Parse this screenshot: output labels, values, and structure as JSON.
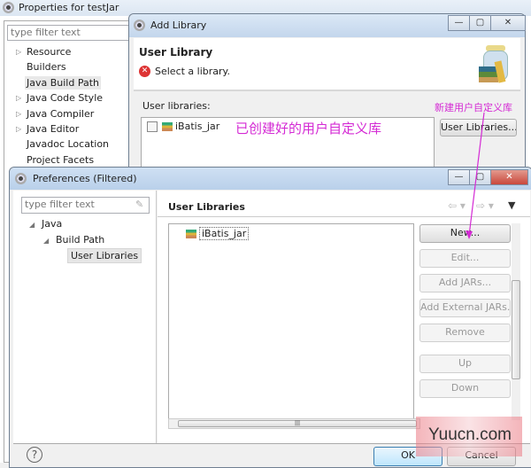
{
  "properties_window": {
    "title": "Properties for testJar",
    "filter_placeholder": "type filter text",
    "tree": [
      {
        "label": "Resource",
        "expandable": true
      },
      {
        "label": "Builders",
        "expandable": false
      },
      {
        "label": "Java Build Path",
        "expandable": false,
        "selected": true
      },
      {
        "label": "Java Code Style",
        "expandable": true
      },
      {
        "label": "Java Compiler",
        "expandable": true
      },
      {
        "label": "Java Editor",
        "expandable": true
      },
      {
        "label": "Javadoc Location",
        "expandable": false
      },
      {
        "label": "Project Facets",
        "expandable": false
      }
    ]
  },
  "add_library_dialog": {
    "title": "Add Library",
    "header_title": "User Library",
    "error_message": "Select a library.",
    "list_label": "User libraries:",
    "libraries": [
      {
        "label": "iBatis_jar",
        "checked": false
      }
    ],
    "user_libraries_button": "User Libraries...",
    "window_buttons": {
      "minimize": "—",
      "maximize": "▢",
      "close": "✕"
    }
  },
  "annotations": {
    "created_library_note": "已创建好的用户自定义库",
    "new_library_note": "新建用户自定义库",
    "color": "#d42ad4"
  },
  "preferences_dialog": {
    "title": "Preferences (Filtered)",
    "filter_placeholder": "type filter text",
    "tree": [
      {
        "label": "Java",
        "level": 0
      },
      {
        "label": "Build Path",
        "level": 1
      },
      {
        "label": "User Libraries",
        "level": 2,
        "selected": true
      }
    ],
    "page_title": "User Libraries",
    "libraries": [
      "iBatis_jar"
    ],
    "buttons": [
      {
        "label": "New...",
        "enabled": true
      },
      {
        "label": "Edit...",
        "enabled": false
      },
      {
        "label": "Add JARs...",
        "enabled": false
      },
      {
        "label": "Add External JARs...",
        "enabled": false
      },
      {
        "label": "Remove",
        "enabled": false
      },
      {
        "label": "Up",
        "enabled": false
      },
      {
        "label": "Down",
        "enabled": false
      }
    ],
    "ok_label": "OK",
    "cancel_label": "Cancel",
    "help_icon": "?",
    "close_color": "#c9473b"
  },
  "watermark": "Yuucn.com"
}
